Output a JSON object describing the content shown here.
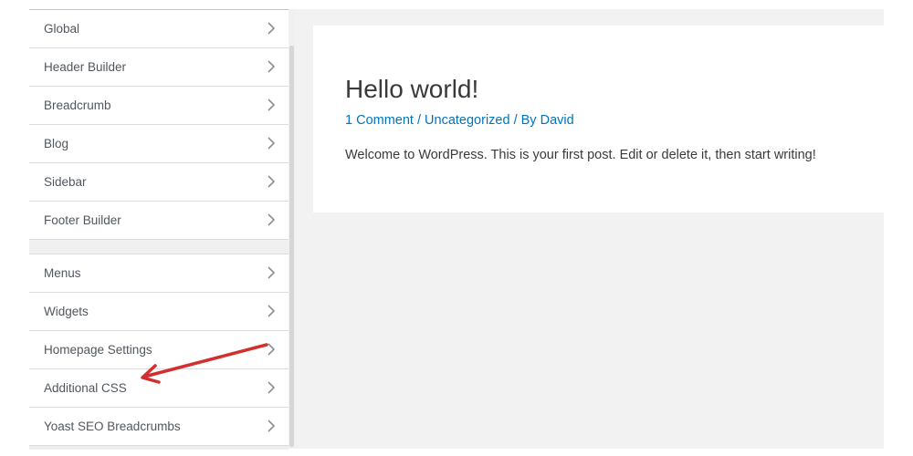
{
  "sidebar": {
    "group1": [
      {
        "label": "Global"
      },
      {
        "label": "Header Builder"
      },
      {
        "label": "Breadcrumb"
      },
      {
        "label": "Blog"
      },
      {
        "label": "Sidebar"
      },
      {
        "label": "Footer Builder"
      }
    ],
    "group2": [
      {
        "label": "Menus"
      },
      {
        "label": "Widgets"
      },
      {
        "label": "Homepage Settings"
      },
      {
        "label": "Additional CSS"
      },
      {
        "label": "Yoast SEO Breadcrumbs"
      }
    ]
  },
  "preview": {
    "post": {
      "title": "Hello world!",
      "meta": {
        "comments": "1 Comment",
        "separator1": " / ",
        "category": "Uncategorized",
        "separator2": " / By ",
        "author": "David"
      },
      "excerpt": "Welcome to WordPress. This is your first post. Edit or delete it, then start writing!"
    }
  },
  "annotation": {
    "arrow_color": "#d32f2f",
    "points_to": "Additional CSS"
  },
  "icons": {
    "item_chevron": "chevron-right-icon"
  }
}
